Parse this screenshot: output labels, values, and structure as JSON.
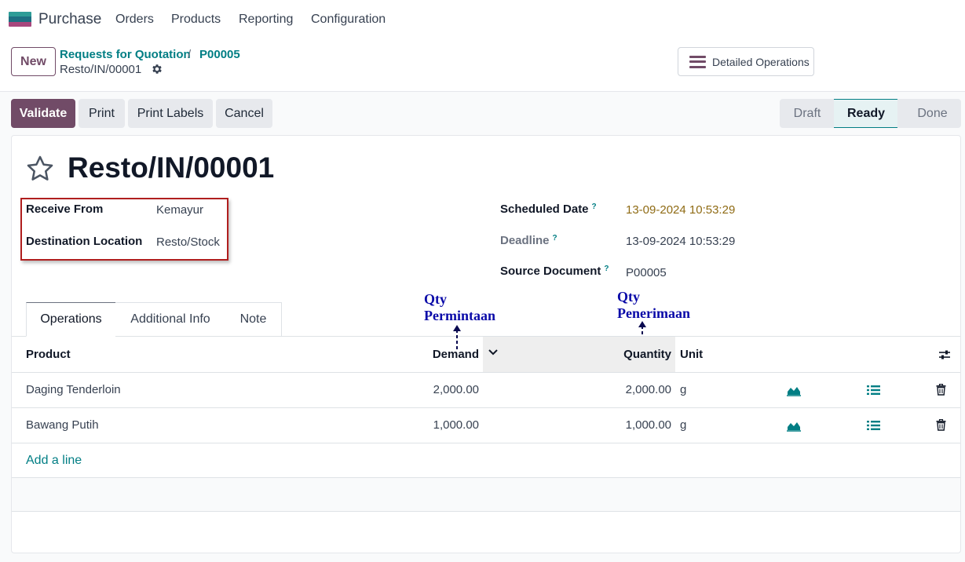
{
  "app": {
    "name": "Purchase"
  },
  "menu": [
    "Orders",
    "Products",
    "Reporting",
    "Configuration"
  ],
  "control": {
    "new_label": "New",
    "breadcrumb": [
      "Requests for Quotation",
      "P00005"
    ],
    "breadcrumb_sep": "/",
    "record": "Resto/IN/00001",
    "detailed_ops_label": "Detailed Operations"
  },
  "actions": {
    "validate": "Validate",
    "print": "Print",
    "print_labels": "Print Labels",
    "cancel": "Cancel"
  },
  "statusbar": {
    "stages": [
      "Draft",
      "Ready",
      "Done"
    ],
    "current": "Ready"
  },
  "form": {
    "title": "Resto/IN/00001",
    "receive_from_label": "Receive From",
    "receive_from_value": "Kemayur",
    "dest_location_label": "Destination Location",
    "dest_location_value": "Resto/Stock",
    "scheduled_date_label": "Scheduled Date",
    "scheduled_date_value": "13-09-2024 10:53:29",
    "deadline_label": "Deadline",
    "deadline_value": "13-09-2024 10:53:29",
    "source_doc_label": "Source Document",
    "source_doc_value": "P00005",
    "help_mark": "?"
  },
  "tabs": [
    "Operations",
    "Additional Info",
    "Note"
  ],
  "annotations": {
    "demand": [
      "Qty",
      "Permintaan"
    ],
    "quantity": [
      "Qty",
      "Penerimaan"
    ]
  },
  "table": {
    "headers": {
      "product": "Product",
      "demand": "Demand",
      "quantity": "Quantity",
      "unit": "Unit"
    },
    "rows": [
      {
        "product": "Daging Tenderloin",
        "demand": "2,000.00",
        "quantity": "2,000.00",
        "unit": "g"
      },
      {
        "product": "Bawang Putih",
        "demand": "1,000.00",
        "quantity": "1,000.00",
        "unit": "g"
      }
    ],
    "add_line": "Add a line"
  },
  "colors": {
    "primary": "#714b67",
    "link": "#017e84",
    "annotation": "#0a0aa8",
    "highlight": "#b01e1e"
  }
}
